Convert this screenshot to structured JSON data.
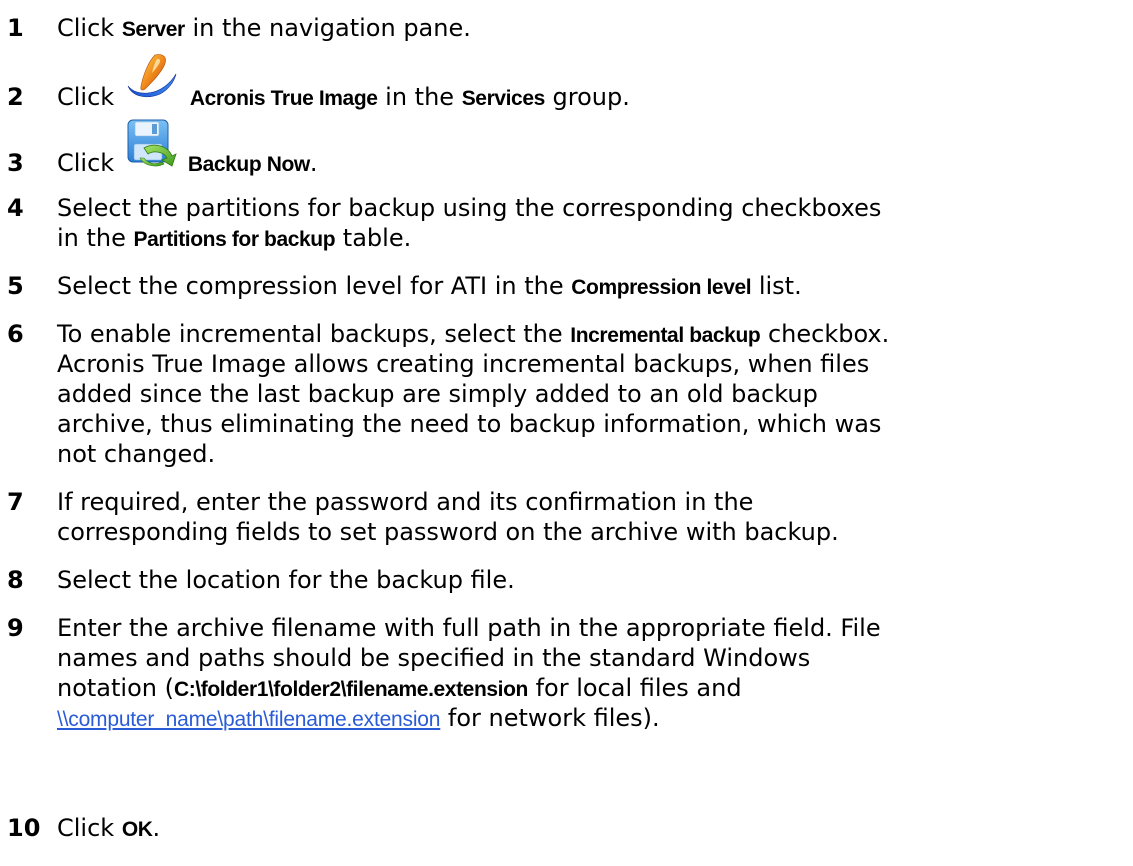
{
  "steps": [
    {
      "number": "1",
      "t1": "Click ",
      "ui1": "Server",
      "t2": " in the navigation pane."
    },
    {
      "number": "2",
      "t1": "Click ",
      "icon": "acronis-true-image-icon",
      "ui1": "Acronis True Image",
      "t2": " in the ",
      "ui2": "Services",
      "t3": " group."
    },
    {
      "number": "3",
      "t1": "Click ",
      "icon": "backup-now-icon",
      "ui1": "Backup Now",
      "t2": "."
    },
    {
      "number": "4",
      "l1": "Select the partitions for backup using the corresponding checkboxes",
      "t1": "in the ",
      "ui1": "Partitions for backup",
      "t2": " table."
    },
    {
      "number": "5",
      "t1": "Select the compression level for ATI in the ",
      "ui1": "Compression level",
      "t2": " list."
    },
    {
      "number": "6",
      "t1": "To enable incremental backups, select the ",
      "ui1": "Incremental backup",
      "t2": " checkbox.",
      "l2": "Acronis True Image allows creating incremental backups, when files",
      "l3": "added since the last backup are simply added to an old backup",
      "l4": "archive, thus eliminating the need to backup information, which was",
      "l5": "not changed."
    },
    {
      "number": "7",
      "l1": "If required, enter the password and its confirmation in the",
      "l2": "corresponding fields to set password on the archive with backup."
    },
    {
      "number": "8",
      "l1": "Select the location for the backup file."
    },
    {
      "number": "9",
      "l1": "Enter the archive filename with full path in the appropriate field. File",
      "l2": "names and paths should be specified in the standard Windows",
      "t1": "notation (",
      "ui1": "C:\\folder1\\folder2\\filename.extension",
      "t2": " for local files and",
      "link": "\\\\computer_name\\path\\filename.extension",
      "t3": " for network files)."
    },
    {
      "number": "10",
      "t1": "Click ",
      "ui1": "OK",
      "t2": "."
    }
  ],
  "colors": {
    "link": "#2a5bd7",
    "text": "#000000"
  }
}
